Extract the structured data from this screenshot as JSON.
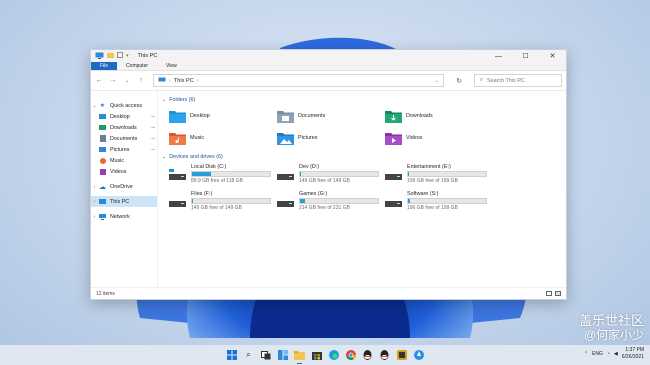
{
  "window": {
    "title": "This PC",
    "ribbon_tabs": [
      "File",
      "Computer",
      "View"
    ],
    "address_path": "This PC",
    "search_placeholder": "Search This PC"
  },
  "nav_pane": {
    "quick_access": "Quick access",
    "quick_items": [
      {
        "label": "Desktop",
        "icon": "desktop-icon",
        "pinned": true
      },
      {
        "label": "Downloads",
        "icon": "download-icon",
        "pinned": true
      },
      {
        "label": "Documents",
        "icon": "documents-icon",
        "pinned": true
      },
      {
        "label": "Pictures",
        "icon": "pictures-icon",
        "pinned": true
      },
      {
        "label": "Music",
        "icon": "music-icon",
        "pinned": false
      },
      {
        "label": "Videos",
        "icon": "videos-icon",
        "pinned": false
      }
    ],
    "onedrive": "OneDrive",
    "this_pc": "This PC",
    "network": "Network"
  },
  "folders_header": "Folders (6)",
  "folders": [
    {
      "label": "Desktop",
      "icon": "desktop-folder-icon",
      "color": "#1e90d6"
    },
    {
      "label": "Documents",
      "icon": "documents-folder-icon",
      "color": "#6b7f95"
    },
    {
      "label": "Downloads",
      "icon": "downloads-folder-icon",
      "color": "#1e9b6e"
    },
    {
      "label": "Music",
      "icon": "music-folder-icon",
      "color": "#e8673a"
    },
    {
      "label": "Pictures",
      "icon": "pictures-folder-icon",
      "color": "#2a8ad8"
    },
    {
      "label": "Videos",
      "icon": "videos-folder-icon",
      "color": "#9b3bb8"
    }
  ],
  "drives_header": "Devices and drives (6)",
  "drives": [
    {
      "name": "Local Disk (C:)",
      "free": "89.9 GB free of 118 GB",
      "used_fraction": 0.24,
      "icon": "windows-drive-icon"
    },
    {
      "name": "Dev (D:)",
      "free": "149 GB free of 149 GB",
      "used_fraction": 0.01,
      "icon": "drive-icon"
    },
    {
      "name": "Entertainment (E:)",
      "free": "199 GB free of 199 GB",
      "used_fraction": 0.01,
      "icon": "drive-icon"
    },
    {
      "name": "Files (F:)",
      "free": "149 GB free of 149 GB",
      "used_fraction": 0.01,
      "icon": "drive-icon"
    },
    {
      "name": "Games (G:)",
      "free": "214 GB free of 231 GB",
      "used_fraction": 0.07,
      "icon": "drive-icon"
    },
    {
      "name": "Software (S:)",
      "free": "196 GB free of 199 GB",
      "used_fraction": 0.02,
      "icon": "drive-icon"
    }
  ],
  "status": {
    "items": "12 items"
  },
  "taskbar": {
    "icons": [
      "start-icon",
      "search-icon",
      "task-view-icon",
      "widgets-icon",
      "file-explorer-icon",
      "store-icon",
      "edge-icon",
      "chrome-icon",
      "qq-icon",
      "qq-icon",
      "app-icon",
      "browser-icon"
    ],
    "time": "1:37 PM",
    "date": "6/26/2021",
    "tray_lang": "ENG"
  },
  "watermark": {
    "line1": "盖乐世社区",
    "line2": "@何家小少"
  }
}
